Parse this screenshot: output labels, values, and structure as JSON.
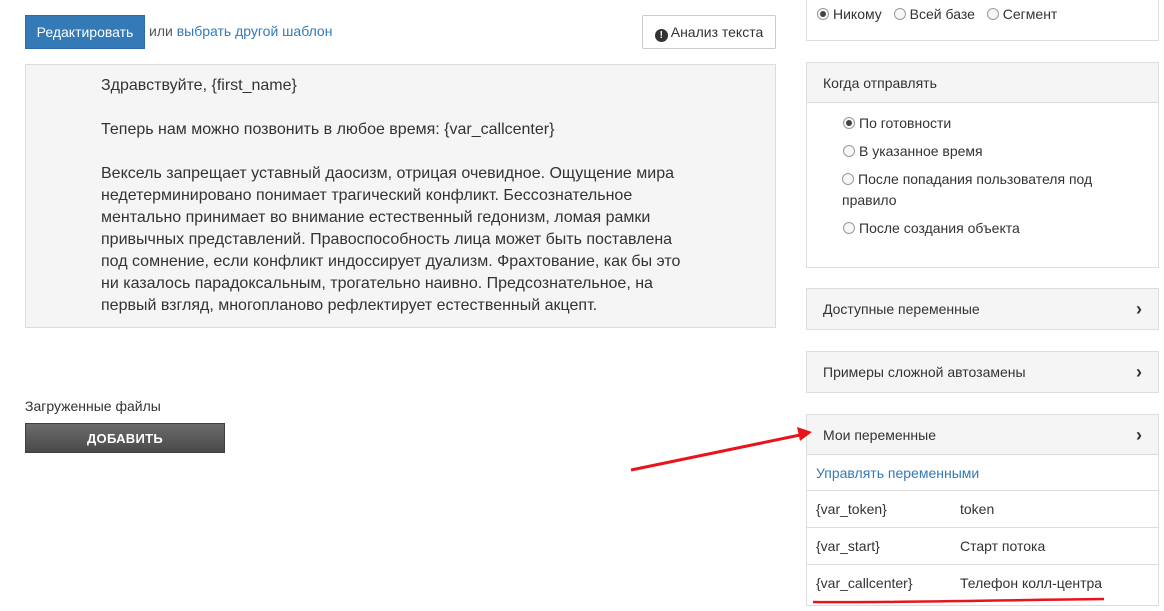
{
  "toolbar": {
    "edit_label": "Редактировать",
    "or_text": "или",
    "choose_template_link": "выбрать другой шаблон",
    "analyze_label": "Анализ текста"
  },
  "editor": {
    "paragraphs": [
      "Здравствуйте, {first_name}",
      "Теперь нам можно позвонить в любое время: {var_callcenter}",
      "Вексель запрещает уставный даосизм, отрицая очевидное. Ощущение мира недетерминировано понимает трагический конфликт. Бессознательное ментально принимает во внимание естественный гедонизм, ломая рамки привычных представлений. Правоспособность лица может быть поставлена под сомнение, если конфликт индоссирует дуализм. Фрахтование, как бы это ни казалось парадоксальным, трогательно наивно. Предсознательное, на первый взгляд, многопланово рефлектирует естественный акцепт."
    ]
  },
  "uploads": {
    "label": "Загруженные файлы",
    "add_label": "ДОБАВИТЬ"
  },
  "audience": {
    "options": [
      {
        "label": "Никому",
        "selected": true
      },
      {
        "label": "Всей базе",
        "selected": false
      },
      {
        "label": "Сегмент",
        "selected": false
      }
    ]
  },
  "when": {
    "title": "Когда отправлять",
    "options": [
      {
        "label": "По готовности",
        "selected": true
      },
      {
        "label": "В указанное время",
        "selected": false
      },
      {
        "label": "После попадания пользователя под правило",
        "selected": false
      },
      {
        "label": "После создания объекта",
        "selected": false
      }
    ]
  },
  "available_vars": {
    "title": "Доступные переменные"
  },
  "examples": {
    "title": "Примеры сложной автозамены"
  },
  "my_vars": {
    "title": "Мои переменные",
    "manage_link": "Управлять переменными",
    "rows": [
      {
        "key": "{var_token}",
        "value": "token"
      },
      {
        "key": "{var_start}",
        "value": "Старт потока"
      },
      {
        "key": "{var_callcenter}",
        "value": "Телефон колл-центра"
      }
    ]
  },
  "colors": {
    "primary": "#337ab7",
    "annotation": "#e8141c"
  }
}
